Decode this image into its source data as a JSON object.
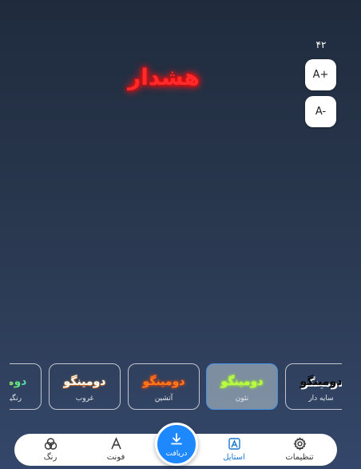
{
  "preview": {
    "text": "هشدار",
    "color": "#ff2a2a"
  },
  "font_size": {
    "value": "۴۲",
    "increase_label": "A+",
    "decrease_label": "A-"
  },
  "styles": [
    {
      "preview": "دومینگو",
      "label": "رنگین‌کمان",
      "effect": "color"
    },
    {
      "preview": "دومینگو",
      "label": "غروب",
      "effect": "sunset"
    },
    {
      "preview": "دومینگو",
      "label": "آتشین",
      "effect": "fire"
    },
    {
      "preview": "دومینگو",
      "label": "نئون",
      "effect": "neon",
      "selected": true
    },
    {
      "preview": "دومینگو",
      "label": "سایه دار",
      "effect": "shadow"
    }
  ],
  "bottom_nav": {
    "settings": "تنظیمات",
    "style": "استایل",
    "download": "دریافت",
    "font": "فونت",
    "color": "رنگ"
  },
  "colors": {
    "accent": "#1976d2",
    "fab": "#1e88ff",
    "selected_card_border": "#4a90e2"
  }
}
